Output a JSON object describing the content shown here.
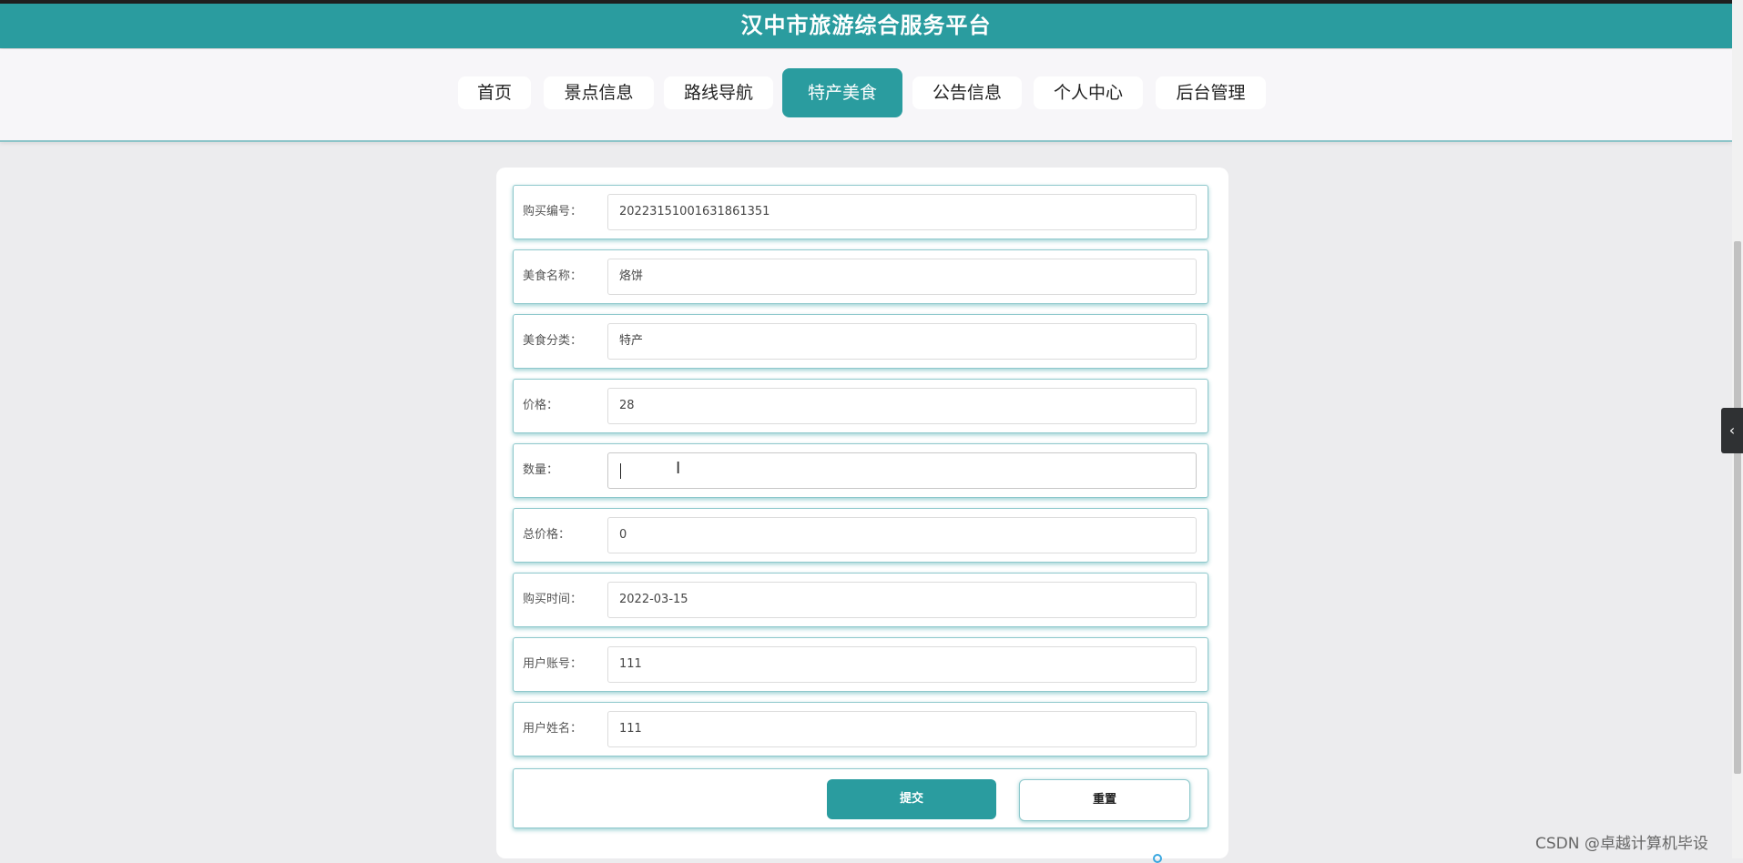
{
  "header": {
    "title": "汉中市旅游综合服务平台"
  },
  "nav": {
    "items": [
      {
        "label": "首页"
      },
      {
        "label": "景点信息"
      },
      {
        "label": "路线导航"
      },
      {
        "label": "特产美食",
        "active": true
      },
      {
        "label": "公告信息"
      },
      {
        "label": "个人中心"
      },
      {
        "label": "后台管理"
      }
    ]
  },
  "form": {
    "fields": [
      {
        "label": "购买编号：",
        "value": "20223151001631861351"
      },
      {
        "label": "美食名称：",
        "value": "烙饼"
      },
      {
        "label": "美食分类：",
        "value": "特产"
      },
      {
        "label": "价格：",
        "value": "28"
      },
      {
        "label": "数量：",
        "value": ""
      },
      {
        "label": "总价格：",
        "value": "0"
      },
      {
        "label": "购买时间：",
        "value": "2022-03-15"
      },
      {
        "label": "用户账号：",
        "value": "111"
      },
      {
        "label": "用户姓名：",
        "value": "111"
      }
    ],
    "submit_label": "提交",
    "reset_label": "重置"
  },
  "side_tab": {
    "icon": "chevron-left-icon",
    "glyph": "‹"
  },
  "watermark": "CSDN @卓越计算机毕设",
  "colors": {
    "primary": "#2a9c9f",
    "background": "#ececee"
  }
}
